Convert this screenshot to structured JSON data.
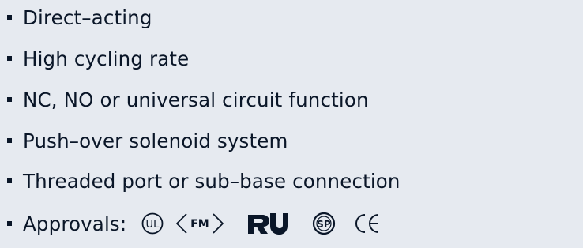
{
  "features": [
    "Direct–acting",
    "High cycling rate",
    "NC, NO or universal circuit function",
    "Push–over solenoid system",
    "Threaded port or sub–base connection"
  ],
  "approvals": {
    "label": "Approvals:",
    "marks": {
      "ul": "UL",
      "fm": "FM",
      "ur": "RU",
      "csa": "SP",
      "ce": "CE"
    }
  },
  "colors": {
    "background": "#e6eaf0",
    "text": "#0a1628"
  }
}
